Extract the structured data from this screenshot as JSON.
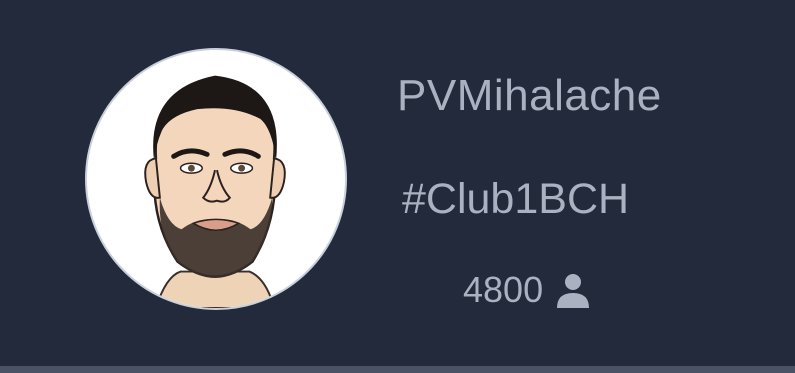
{
  "profile": {
    "username": "PVMihalache",
    "club_tag": "#Club1BCH",
    "follower_count": "4800",
    "follower_icon": "user-icon",
    "avatar": "avatar-illustration-bearded-man"
  },
  "colors": {
    "background": "#222a3b",
    "text": "#aab2c2",
    "bottom_border": "#4a5366",
    "avatar_background": "#ffffff"
  }
}
